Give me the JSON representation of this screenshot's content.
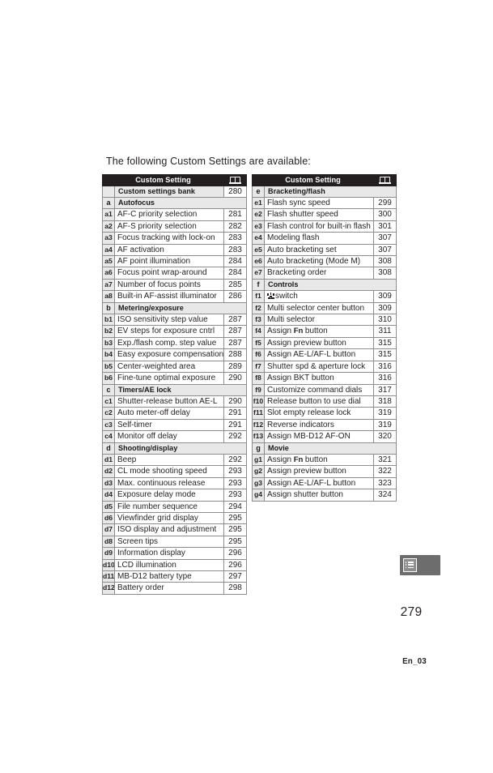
{
  "page": {
    "intro": "The following Custom Settings are available:",
    "page_number": "279",
    "footer_code": "En_03",
    "side_tab_icon": "menu-list-icon"
  },
  "table_header": {
    "title": "Custom Setting",
    "page_icon": "open-book-icon"
  },
  "left_table": {
    "bank": {
      "id": "",
      "name": "Custom settings bank",
      "page": "280"
    },
    "groups": [
      {
        "id": "a",
        "name": "Autofocus",
        "rows": [
          {
            "id": "a1",
            "name": "AF-C priority selection",
            "page": "281"
          },
          {
            "id": "a2",
            "name": "AF-S priority selection",
            "page": "282"
          },
          {
            "id": "a3",
            "name": "Focus tracking with lock-on",
            "page": "283"
          },
          {
            "id": "a4",
            "name": "AF activation",
            "page": "283"
          },
          {
            "id": "a5",
            "name": "AF point illumination",
            "page": "284"
          },
          {
            "id": "a6",
            "name": "Focus point wrap-around",
            "page": "284"
          },
          {
            "id": "a7",
            "name": "Number of focus points",
            "page": "285"
          },
          {
            "id": "a8",
            "name": "Built-in AF-assist illuminator",
            "page": "286"
          }
        ]
      },
      {
        "id": "b",
        "name": "Metering/exposure",
        "rows": [
          {
            "id": "b1",
            "name": "ISO sensitivity step value",
            "page": "287"
          },
          {
            "id": "b2",
            "name": "EV steps for exposure cntrl",
            "page": "287"
          },
          {
            "id": "b3",
            "name": "Exp./flash comp. step value",
            "page": "287"
          },
          {
            "id": "b4",
            "name": "Easy exposure compensation",
            "page": "288"
          },
          {
            "id": "b5",
            "name": "Center-weighted area",
            "page": "289"
          },
          {
            "id": "b6",
            "name": "Fine-tune optimal exposure",
            "page": "290"
          }
        ]
      },
      {
        "id": "c",
        "name": "Timers/AE lock",
        "rows": [
          {
            "id": "c1",
            "name": "Shutter-release button AE-L",
            "page": "290"
          },
          {
            "id": "c2",
            "name": "Auto meter-off delay",
            "page": "291"
          },
          {
            "id": "c3",
            "name": "Self-timer",
            "page": "291"
          },
          {
            "id": "c4",
            "name": "Monitor off delay",
            "page": "292"
          }
        ]
      },
      {
        "id": "d",
        "name": "Shooting/display",
        "rows": [
          {
            "id": "d1",
            "name": "Beep",
            "page": "292"
          },
          {
            "id": "d2",
            "name": "CL mode shooting speed",
            "page": "293"
          },
          {
            "id": "d3",
            "name": "Max. continuous release",
            "page": "293"
          },
          {
            "id": "d4",
            "name": "Exposure delay mode",
            "page": "293"
          },
          {
            "id": "d5",
            "name": "File number sequence",
            "page": "294"
          },
          {
            "id": "d6",
            "name": "Viewfinder grid display",
            "page": "295"
          },
          {
            "id": "d7",
            "name": "ISO display and adjustment",
            "page": "295"
          },
          {
            "id": "d8",
            "name": "Screen tips",
            "page": "295"
          },
          {
            "id": "d9",
            "name": "Information display",
            "page": "296"
          },
          {
            "id": "d10",
            "name": "LCD illumination",
            "page": "296"
          },
          {
            "id": "d11",
            "name": "MB-D12 battery type",
            "page": "297"
          },
          {
            "id": "d12",
            "name": "Battery order",
            "page": "298"
          }
        ]
      }
    ]
  },
  "right_table": {
    "groups": [
      {
        "id": "e",
        "name": "Bracketing/flash",
        "rows": [
          {
            "id": "e1",
            "name": "Flash sync speed",
            "page": "299"
          },
          {
            "id": "e2",
            "name": "Flash shutter speed",
            "page": "300"
          },
          {
            "id": "e3",
            "name": "Flash control for built-in flash",
            "page": "301"
          },
          {
            "id": "e4",
            "name": "Modeling flash",
            "page": "307"
          },
          {
            "id": "e5",
            "name": "Auto bracketing set",
            "page": "307"
          },
          {
            "id": "e6",
            "name": "Auto bracketing (Mode M)",
            "page": "308"
          },
          {
            "id": "e7",
            "name": "Bracketing order",
            "page": "308"
          }
        ]
      },
      {
        "id": "f",
        "name": "Controls",
        "rows": [
          {
            "id": "f1",
            "name": "switch",
            "icon": "camera-switch-icon",
            "page": "309"
          },
          {
            "id": "f2",
            "name": "Multi selector center button",
            "page": "309"
          },
          {
            "id": "f3",
            "name": "Multi selector",
            "page": "310"
          },
          {
            "id": "f4",
            "name": "Assign Fn button",
            "fn": true,
            "page": "311"
          },
          {
            "id": "f5",
            "name": "Assign preview button",
            "page": "315"
          },
          {
            "id": "f6",
            "name": "Assign AE-L/AF-L button",
            "page": "315"
          },
          {
            "id": "f7",
            "name": "Shutter spd & aperture lock",
            "page": "316"
          },
          {
            "id": "f8",
            "name": "Assign BKT button",
            "page": "316"
          },
          {
            "id": "f9",
            "name": "Customize command dials",
            "page": "317"
          },
          {
            "id": "f10",
            "name": "Release button to use dial",
            "page": "318"
          },
          {
            "id": "f11",
            "name": "Slot empty release lock",
            "page": "319"
          },
          {
            "id": "f12",
            "name": "Reverse indicators",
            "page": "319"
          },
          {
            "id": "f13",
            "name": "Assign MB-D12 AF-ON",
            "page": "320"
          }
        ]
      },
      {
        "id": "g",
        "name": "Movie",
        "rows": [
          {
            "id": "g1",
            "name": "Assign Fn button",
            "fn": true,
            "page": "321"
          },
          {
            "id": "g2",
            "name": "Assign preview button",
            "page": "322"
          },
          {
            "id": "g3",
            "name": "Assign AE-L/AF-L button",
            "page": "323"
          },
          {
            "id": "g4",
            "name": "Assign shutter button",
            "page": "324"
          }
        ]
      }
    ]
  },
  "colors": {
    "header_bg": "#231f20",
    "row_shade": "#e8e8e8",
    "border": "#8d8d8d",
    "text": "#231f20",
    "tab_bg": "#6d6d6d"
  }
}
